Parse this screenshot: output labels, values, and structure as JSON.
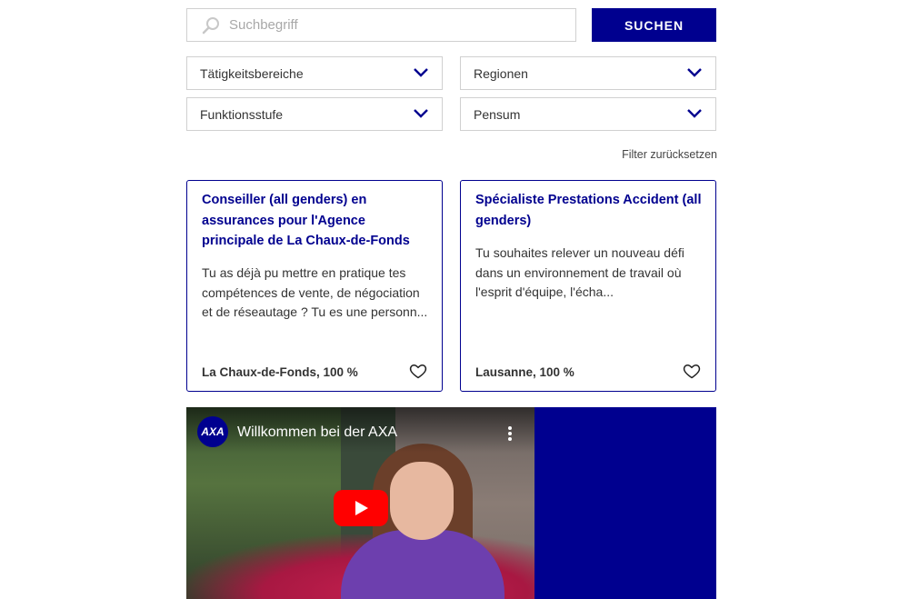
{
  "search": {
    "placeholder": "Suchbegriff",
    "button_label": "SUCHEN"
  },
  "filters": [
    {
      "label": "Tätigkeitsbereiche"
    },
    {
      "label": "Regionen"
    },
    {
      "label": "Funktionsstufe"
    },
    {
      "label": "Pensum"
    }
  ],
  "reset_label": "Filter zurücksetzen",
  "jobs": [
    {
      "title": "Conseiller (all genders) en assurances pour l'Agence principale de La Chaux-de-Fonds",
      "description": "Tu as déjà pu mettre en pratique tes compétences de vente, de négociation et de réseautage ? Tu es une personn...",
      "location": "La Chaux-de-Fonds, 100 %"
    },
    {
      "title": "Spécialiste Prestations Accident (all genders)",
      "description": "Tu souhaites relever un nouveau défi dans un environnement de travail où l'esprit d'équipe, l'écha...",
      "location": "Lausanne, 100 %"
    }
  ],
  "video": {
    "title": "Willkommen bei der AXA",
    "logo_text": "AXA"
  },
  "colors": {
    "brand": "#00008f",
    "play_button": "#ff0000"
  }
}
